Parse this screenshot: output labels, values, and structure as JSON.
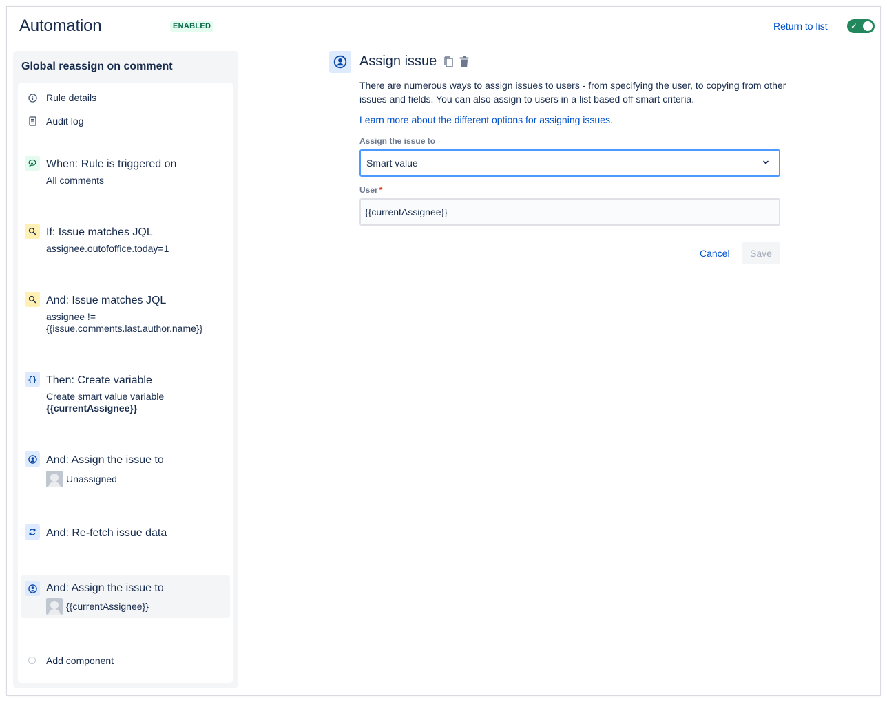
{
  "header": {
    "app_title": "Automation",
    "status": "ENABLED",
    "return_link": "Return to list",
    "toggle_state": "on"
  },
  "sidebar": {
    "rule_name": "Global reassign on comment",
    "meta_items": [
      {
        "label": "Rule details",
        "icon": "info-icon"
      },
      {
        "label": "Audit log",
        "icon": "document-icon"
      }
    ],
    "steps": [
      {
        "title": "When: Rule is triggered on",
        "desc": "All comments",
        "icon": "comment-trigger-icon"
      },
      {
        "title": "If: Issue matches JQL",
        "desc": "assignee.outofoffice.today=1",
        "icon": "search-icon"
      },
      {
        "title": "And: Issue matches JQL",
        "desc_line1": "assignee !=",
        "desc_line2": "{{issue.comments.last.author.name}}",
        "icon": "search-icon"
      },
      {
        "title": "Then: Create variable",
        "desc_line1": "Create smart value variable",
        "desc_line2": "{{currentAssignee}}",
        "icon": "braces-icon"
      },
      {
        "title": "And: Assign the issue to",
        "desc": "Unassigned",
        "icon": "user-circle-icon"
      },
      {
        "title": "And: Re-fetch issue data",
        "icon": "refresh-icon"
      },
      {
        "title": "And: Assign the issue to",
        "desc": "{{currentAssignee}}",
        "icon": "user-circle-icon"
      }
    ],
    "add_component": "Add component"
  },
  "main": {
    "title": "Assign issue",
    "description": "There are numerous ways to assign issues to users - from specifying the user, to copying from other issues and fields. You can also assign to users in a list based off smart criteria.",
    "learn_more": "Learn more about the different options for assigning issues.",
    "assign_label": "Assign the issue to",
    "assign_value": "Smart value",
    "user_label": "User",
    "required_marker": "*",
    "user_value": "{{currentAssignee}}",
    "cancel": "Cancel",
    "save": "Save"
  },
  "colors": {
    "link": "#0052cc",
    "toggle_on": "#22875c",
    "focus_border": "#4c9aff",
    "trigger_bg": "#e3fcef",
    "condition_bg": "#fff0b3",
    "action_bg": "#deebff"
  }
}
